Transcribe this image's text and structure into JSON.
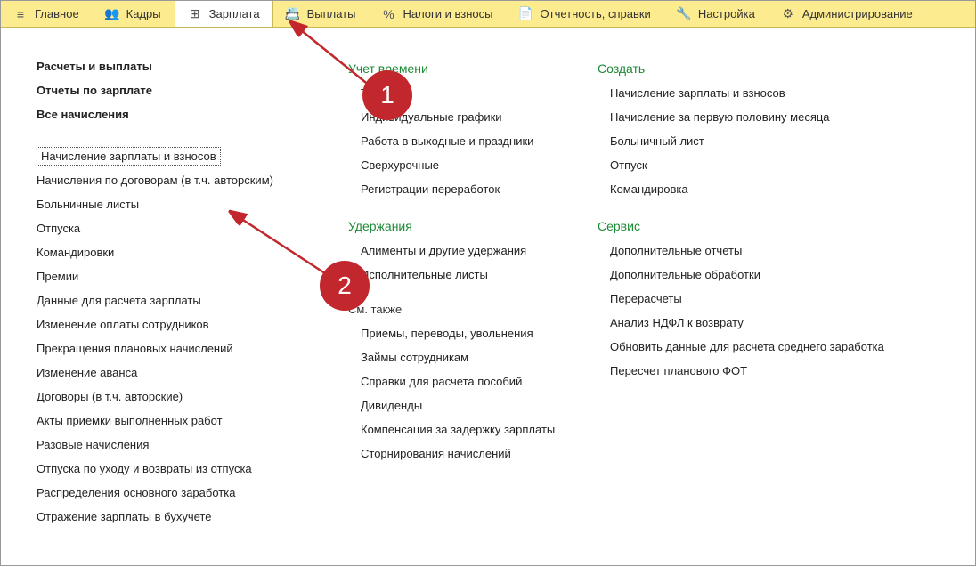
{
  "topbar": {
    "items": [
      {
        "label": "Главное",
        "icon": "≡"
      },
      {
        "label": "Кадры",
        "icon": "👥"
      },
      {
        "label": "Зарплата",
        "icon": "⊞"
      },
      {
        "label": "Выплаты",
        "icon": "📇"
      },
      {
        "label": "Налоги и взносы",
        "icon": "%"
      },
      {
        "label": "Отчетность, справки",
        "icon": "📄"
      },
      {
        "label": "Настройка",
        "icon": "🔧"
      },
      {
        "label": "Администрирование",
        "icon": "⚙"
      }
    ]
  },
  "col1": {
    "headings": [
      "Расчеты и выплаты",
      "Отчеты по зарплате",
      "Все начисления"
    ],
    "items": [
      "Начисление зарплаты и взносов",
      "Начисления по договорам (в т.ч. авторским)",
      "Больничные листы",
      "Отпуска",
      "Командировки",
      "Премии",
      "Данные для расчета зарплаты",
      "Изменение оплаты сотрудников",
      "Прекращения плановых начислений",
      "Изменение аванса",
      "Договоры (в т.ч. авторские)",
      "Акты приемки выполненных работ",
      "Разовые начисления",
      "Отпуска по уходу и возвраты из отпуска",
      "Распределения основного заработка",
      "Отражение зарплаты в бухучете"
    ]
  },
  "col2": {
    "sec1_title": "Учет времени",
    "sec1_items": [
      "Табели",
      "Индивидуальные графики",
      "Работа в выходные и праздники",
      "Сверхурочные",
      "Регистрации переработок"
    ],
    "sec2_title": "Удержания",
    "sec2_items": [
      "Алименты и другие удержания",
      "Исполнительные листы"
    ],
    "sec3_title": "См. также",
    "sec3_items": [
      "Приемы, переводы, увольнения",
      "Займы сотрудникам",
      "Справки для расчета пособий",
      "Дивиденды",
      "Компенсация за задержку зарплаты",
      "Сторнирования начислений"
    ]
  },
  "col3": {
    "sec1_title": "Создать",
    "sec1_items": [
      "Начисление зарплаты и взносов",
      "Начисление за первую половину месяца",
      "Больничный лист",
      "Отпуск",
      "Командировка"
    ],
    "sec2_title": "Сервис",
    "sec2_items": [
      "Дополнительные отчеты",
      "Дополнительные обработки",
      "Перерасчеты",
      "Анализ НДФЛ к возврату",
      "Обновить данные для расчета среднего заработка",
      "Пересчет планового ФОТ"
    ]
  },
  "badges": {
    "one": "1",
    "two": "2"
  }
}
